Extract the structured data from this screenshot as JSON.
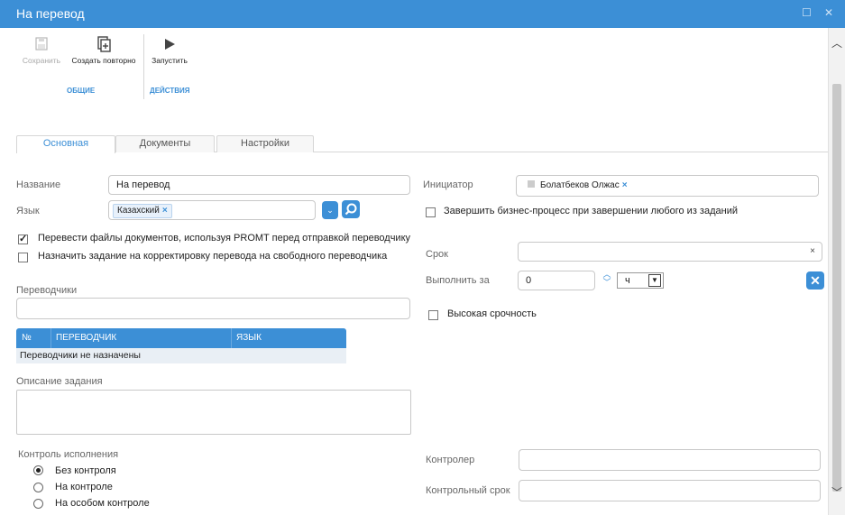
{
  "window": {
    "title": "На перевод",
    "maximize_glyph": "☐",
    "close_glyph": "✕"
  },
  "toolbar": {
    "save_label": "Сохранить",
    "recreate_label": "Создать повторно",
    "run_label": "Запустить",
    "group_general": "ОБЩИЕ",
    "group_actions": "ДЕЙСТВИЯ"
  },
  "tabs": [
    {
      "label": "Основная"
    },
    {
      "label": "Документы"
    },
    {
      "label": "Настройки"
    }
  ],
  "form": {
    "name_label": "Название",
    "name_value": "На перевод",
    "language_label": "Язык",
    "language_tag": "Казахский",
    "translate_promt_label": "Перевести файлы документов, используя PROMT перед отправкой переводчику",
    "assign_review_label": "Назначить задание на корректировку перевода на свободного переводчика",
    "translators_label": "Переводчики",
    "task_description_label": "Описание задания",
    "control_label": "Контроль исполнения",
    "control_options": [
      "Без контроля",
      "На контроле",
      "На особом контроле"
    ],
    "initiator_label": "Инициатор",
    "initiator_tag": "Болатбеков Олжас",
    "finish_process_label": "Завершить бизнес-процесс при завершении любого из заданий",
    "deadline_label": "Срок",
    "execute_in_label": "Выполнить за",
    "execute_in_value": "0",
    "unit_value": "ч",
    "high_urgency_label": "Высокая срочность",
    "controller_label": "Контролер",
    "control_deadline_label": "Контрольный срок"
  },
  "translators_table": {
    "headers": [
      "№",
      "ПЕРЕВОДЧИК",
      "ЯЗЫК"
    ],
    "empty_text": "Переводчики не назначены"
  },
  "colors": {
    "accent": "#3c8fd6",
    "titlebar": "#3c8fd6"
  }
}
